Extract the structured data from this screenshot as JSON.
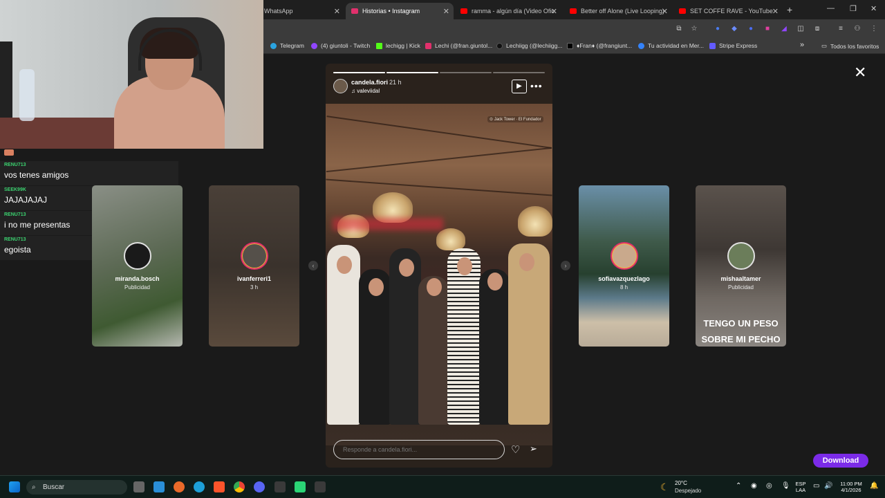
{
  "browser": {
    "tabs": [
      {
        "label": "WhatsApp",
        "fav": "#25d366"
      },
      {
        "label": "Historias • Instagram",
        "fav": "#e1306c",
        "active": true
      },
      {
        "label": "ramma - algún día (Video Ofic",
        "fav": "#ff0000"
      },
      {
        "label": "Better off Alone (Live Looping)",
        "fav": "#ff0000"
      },
      {
        "label": "SET COFFE RAVE - YouTube",
        "fav": "#ff0000"
      }
    ],
    "new_tab": "+",
    "bookmarks": [
      {
        "label": "Telegram",
        "color": "#2aa3e0"
      },
      {
        "label": "(4) giuntoli - Twitch",
        "color": "#9146ff"
      },
      {
        "label": "lechigg | Kick",
        "color": "#53fc18"
      },
      {
        "label": "Lechi (@fran.giuntol...",
        "color": "#e1306c"
      },
      {
        "label": "Lechiigg (@lechiigg...",
        "color": "#111111"
      },
      {
        "label": "♦Fran♦ (@frangiunt...",
        "color": "#000000"
      },
      {
        "label": "Tu actividad en Mer...",
        "color": "#3483fa"
      },
      {
        "label": "Stripe Express",
        "color": "#635bff"
      }
    ],
    "bookmarks_more": "»",
    "all_favorites": "Todos los favoritos"
  },
  "chat": [
    {
      "user": "RENU713",
      "text": "vos tenes amigos"
    },
    {
      "user": "SEEK99K",
      "text": "JAJAJAJAJ"
    },
    {
      "user": "RENU713",
      "text": "i no me presentas"
    },
    {
      "user": "RENU713",
      "text": "egoista"
    }
  ],
  "stories": {
    "left_cards": [
      {
        "username": "miranda.bosch",
        "sub": "Publicidad",
        "bg": "#6c7466"
      },
      {
        "username": "ivanferreri1",
        "sub": "3 h",
        "bg": "#3c3530"
      }
    ],
    "right_cards": [
      {
        "username": "sofiavazquezlago",
        "sub": "8 h",
        "bg": "#4c6b78",
        "overlay": ""
      },
      {
        "username": "mishaaltamer",
        "sub": "Publicidad",
        "bg": "#4a4440",
        "overlay": "TENGO UN PESO SOBRE MI PECHO"
      }
    ],
    "current": {
      "username": "candela.fiori",
      "time": "21 h",
      "music_user": "valeviidal",
      "location_sticker": "⊙ Jack Tower · El Fundador",
      "reply_placeholder": "Responde a candela.fiori...",
      "progress": [
        1,
        1,
        0,
        0
      ]
    },
    "download_label": "Download"
  },
  "taskbar": {
    "search_placeholder": "Buscar",
    "weather_temp": "20°C",
    "weather_desc": "Despejado",
    "lang": "ESP",
    "lang_sub": "LAA",
    "time": "11:00 PM",
    "date": "4/1/2026"
  }
}
